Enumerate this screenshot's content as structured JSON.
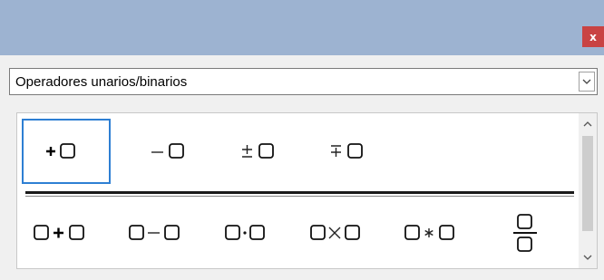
{
  "window": {
    "close_label": "x"
  },
  "dropdown": {
    "value": "Operadores unarios/binarios",
    "icon": "chevron-down-icon"
  },
  "symbols": {
    "unary": [
      "+□",
      "−□",
      "±□",
      "∓□"
    ],
    "binary": [
      "□+□",
      "□−□",
      "□·□",
      "□×□",
      "□∗□",
      "□/□"
    ]
  },
  "colors": {
    "titlebar": "#9db3d1",
    "close": "#c94343",
    "selection": "#2e7fd3"
  }
}
